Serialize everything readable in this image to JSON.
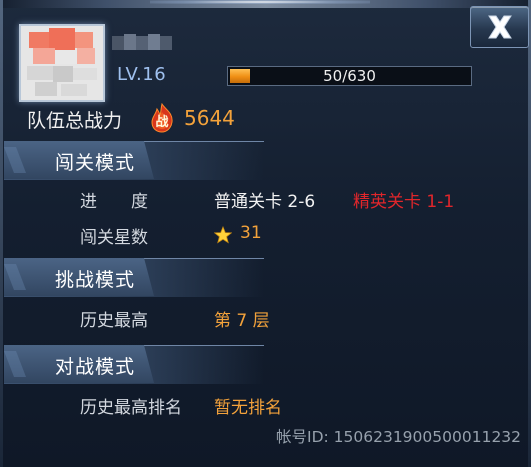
{
  "header": {
    "level": "LV.16",
    "exp": {
      "current": 50,
      "max": 630,
      "text": "50/630"
    },
    "power_label": "队伍总战力",
    "power_icon_text": "战",
    "power_value": "5644"
  },
  "sections": {
    "stage": {
      "title": "闯关模式",
      "progress_label": "进　　度",
      "normal_progress": "普通关卡 2-6",
      "elite_progress": "精英关卡 1-1",
      "stars_label": "闯关星数",
      "stars_value": "31"
    },
    "challenge": {
      "title": "挑战模式",
      "record_label": "历史最高",
      "record_value": "第 7 层"
    },
    "battle": {
      "title": "对战模式",
      "rank_label": "历史最高排名",
      "rank_value": "暂无排名"
    }
  },
  "footer": {
    "account_id": "帐号ID: 150623190050001​1232"
  },
  "colors": {
    "accent_orange": "#f3a23b",
    "elite_red": "#e0262b",
    "level_blue": "#9fc0ee"
  },
  "icons": [
    "close-icon",
    "avatar",
    "power-flame-icon",
    "star-icon"
  ]
}
